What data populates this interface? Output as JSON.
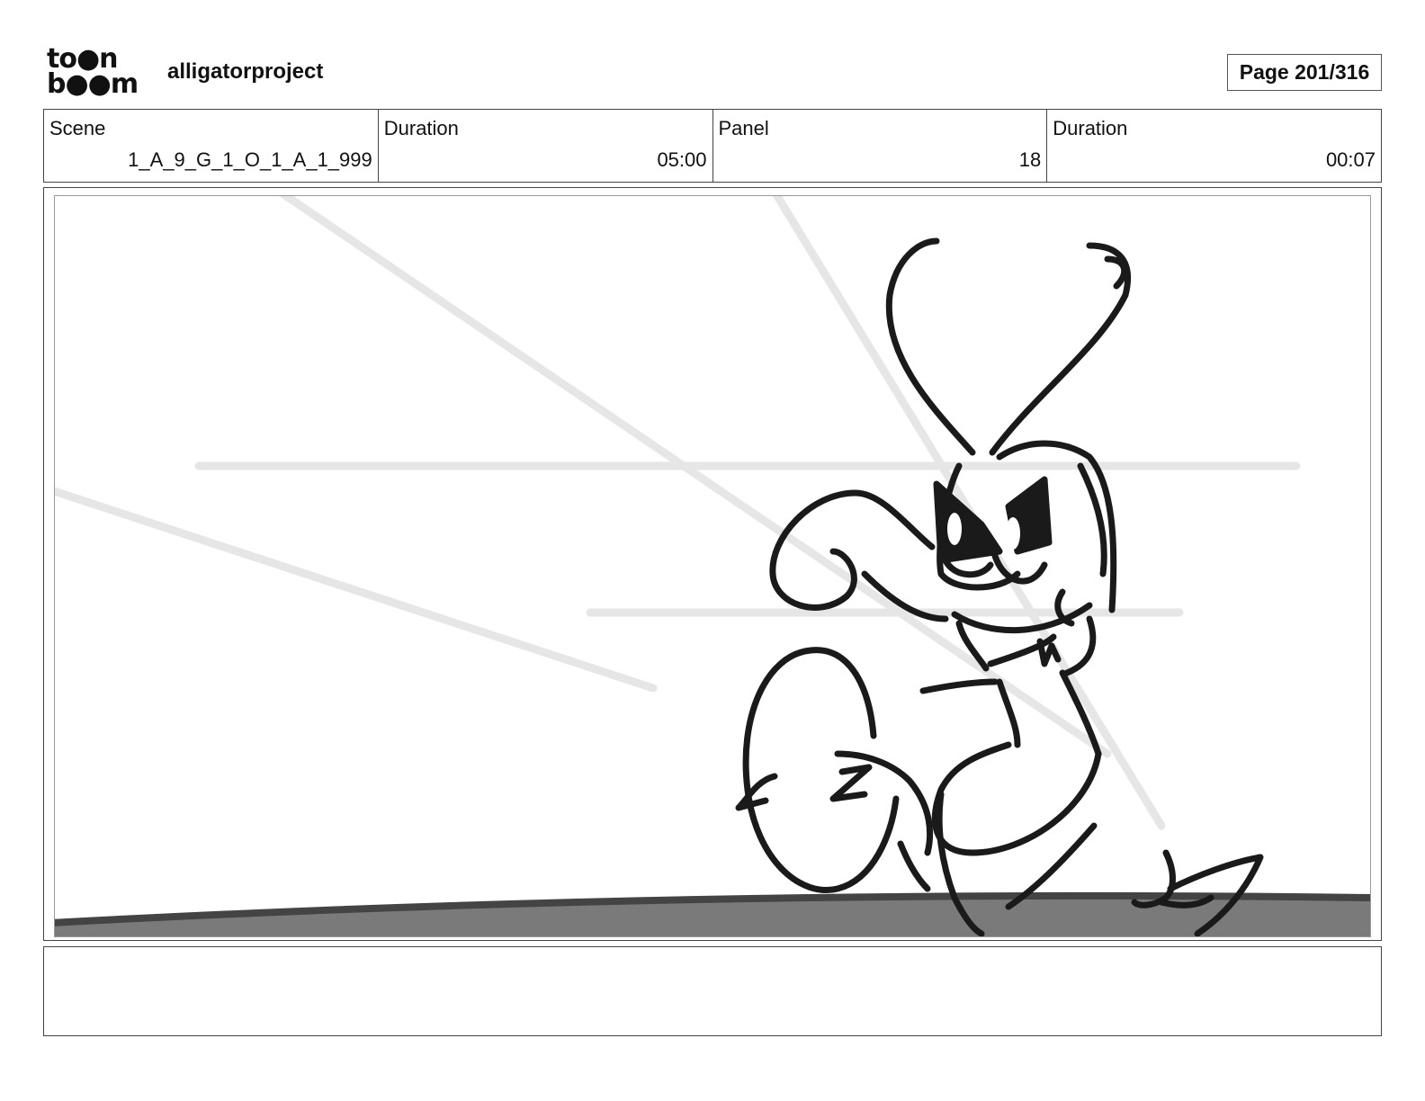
{
  "header": {
    "logo_line1": "to●n",
    "logo_line2": "b●●m",
    "project_name": "alligatorproject",
    "page_label": "Page 201/316"
  },
  "info": [
    {
      "label": "Scene",
      "value": "1_A_9_G_1_O_1_A_1_999"
    },
    {
      "label": "Duration",
      "value": "05:00"
    },
    {
      "label": "Panel",
      "value": "18"
    },
    {
      "label": "Duration",
      "value": "00:07"
    }
  ],
  "panel": {
    "image": "storyboard-sketch",
    "ground_color": "#7a7a7a",
    "line_color": "#1a1a1a"
  },
  "notes": {
    "text": ""
  }
}
